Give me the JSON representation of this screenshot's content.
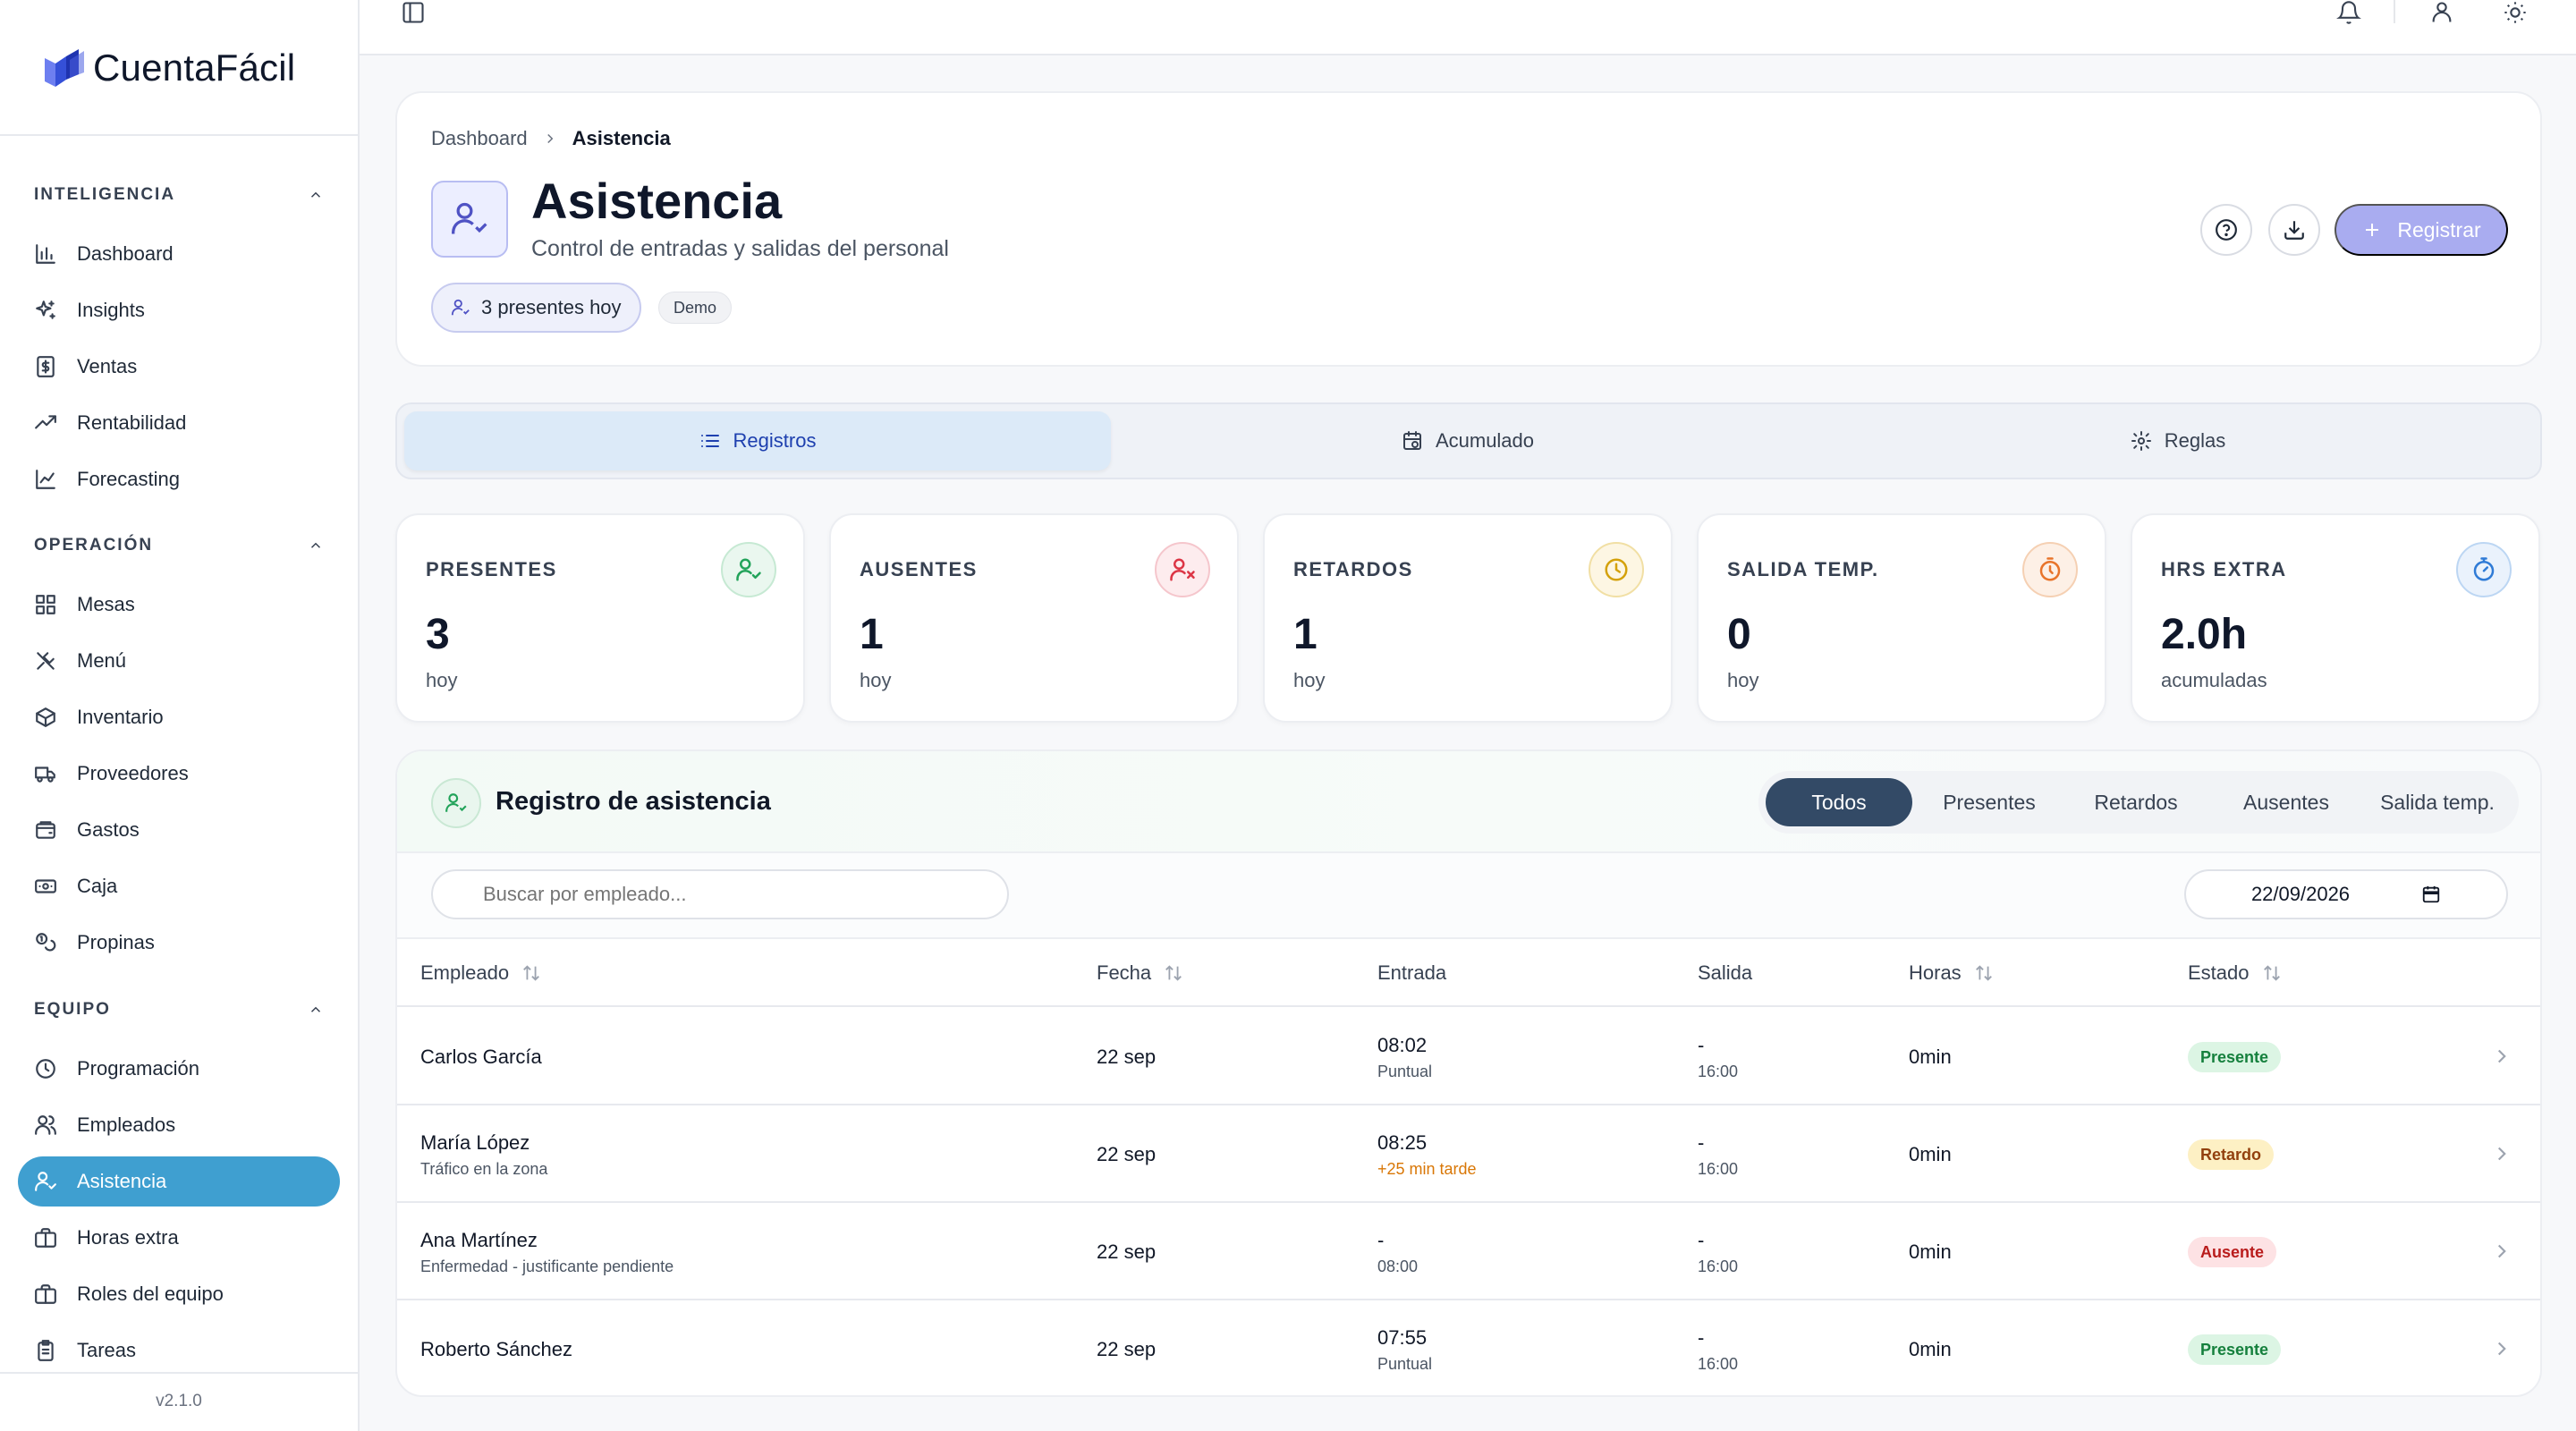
{
  "app": {
    "brand": "CuentaFácil",
    "version": "v2.1.0"
  },
  "sidebar": {
    "sections": [
      {
        "title": "INTELIGENCIA",
        "items": [
          {
            "label": "Dashboard",
            "icon": "bar-chart-icon"
          },
          {
            "label": "Insights",
            "icon": "sparkles-icon"
          },
          {
            "label": "Ventas",
            "icon": "receipt-icon"
          },
          {
            "label": "Rentabilidad",
            "icon": "trending-up-icon"
          },
          {
            "label": "Forecasting",
            "icon": "line-chart-icon"
          }
        ]
      },
      {
        "title": "OPERACIÓN",
        "items": [
          {
            "label": "Mesas",
            "icon": "grid-icon"
          },
          {
            "label": "Menú",
            "icon": "utensils-icon"
          },
          {
            "label": "Inventario",
            "icon": "package-icon"
          },
          {
            "label": "Proveedores",
            "icon": "truck-icon"
          },
          {
            "label": "Gastos",
            "icon": "wallet-icon"
          },
          {
            "label": "Caja",
            "icon": "banknote-icon"
          },
          {
            "label": "Propinas",
            "icon": "coins-icon"
          }
        ]
      },
      {
        "title": "EQUIPO",
        "items": [
          {
            "label": "Programación",
            "icon": "clock-icon"
          },
          {
            "label": "Empleados",
            "icon": "users-icon"
          },
          {
            "label": "Asistencia",
            "icon": "user-check-icon",
            "active": true
          },
          {
            "label": "Horas extra",
            "icon": "briefcase-icon"
          },
          {
            "label": "Roles del equipo",
            "icon": "briefcase-icon"
          },
          {
            "label": "Tareas",
            "icon": "clipboard-icon"
          }
        ]
      }
    ]
  },
  "header": {
    "breadcrumb": {
      "parent": "Dashboard",
      "current": "Asistencia"
    },
    "title": "Asistencia",
    "subtitle": "Control de entradas y salidas del personal",
    "present_pill": "3 presentes hoy",
    "demo_badge": "Demo",
    "register_label": "Registrar"
  },
  "tabs": [
    {
      "label": "Registros",
      "icon": "list-icon",
      "active": true
    },
    {
      "label": "Acumulado",
      "icon": "calendar-clock-icon"
    },
    {
      "label": "Reglas",
      "icon": "gear-icon"
    }
  ],
  "stats": [
    {
      "label": "PRESENTES",
      "value": "3",
      "sub": "hoy",
      "icon": "user-check-icon",
      "color": "#22a35a",
      "bg": "#eaf7ef",
      "border": "#c6e9d3"
    },
    {
      "label": "AUSENTES",
      "value": "1",
      "sub": "hoy",
      "icon": "user-x-icon",
      "color": "#dc3545",
      "bg": "#fdecee",
      "border": "#f5c6cc"
    },
    {
      "label": "RETARDOS",
      "value": "1",
      "sub": "hoy",
      "icon": "clock-icon",
      "color": "#d4a10a",
      "bg": "#fdf6e3",
      "border": "#f1dfa4"
    },
    {
      "label": "SALIDA TEMP.",
      "value": "0",
      "sub": "hoy",
      "icon": "timer-icon",
      "color": "#e8742a",
      "bg": "#fdf0e6",
      "border": "#f5d0b3"
    },
    {
      "label": "HRS EXTRA",
      "value": "2.0h",
      "sub": "acumuladas",
      "icon": "stopwatch-icon",
      "color": "#2f7bd6",
      "bg": "#eaf2fc",
      "border": "#bcd6f3"
    }
  ],
  "table": {
    "title": "Registro de asistencia",
    "filters": [
      "Todos",
      "Presentes",
      "Retardos",
      "Ausentes",
      "Salida temp."
    ],
    "active_filter": "Todos",
    "search_placeholder": "Buscar por empleado...",
    "date_value": "22/09/2026",
    "columns": [
      "Empleado",
      "Fecha",
      "Entrada",
      "Salida",
      "Horas",
      "Estado"
    ],
    "rows": [
      {
        "employee": "Carlos García",
        "note": "",
        "date": "22 sep",
        "in": "08:02",
        "in_note": "Puntual",
        "in_late": false,
        "out": "-",
        "out_note": "16:00",
        "hours": "0min",
        "status": "Presente",
        "status_color": "#15803d",
        "status_bg": "#dcf5e4"
      },
      {
        "employee": "María López",
        "note": "Tráfico en la zona",
        "date": "22 sep",
        "in": "08:25",
        "in_note": "+25 min tarde",
        "in_late": true,
        "out": "-",
        "out_note": "16:00",
        "hours": "0min",
        "status": "Retardo",
        "status_color": "#92400e",
        "status_bg": "#fdf0c4"
      },
      {
        "employee": "Ana Martínez",
        "note": "Enfermedad - justificante pendiente",
        "date": "22 sep",
        "in": "-",
        "in_note": "08:00",
        "in_late": false,
        "out": "-",
        "out_note": "16:00",
        "hours": "0min",
        "status": "Ausente",
        "status_color": "#b91c1c",
        "status_bg": "#fde2e4"
      },
      {
        "employee": "Roberto Sánchez",
        "note": "",
        "date": "22 sep",
        "in": "07:55",
        "in_note": "Puntual",
        "in_late": false,
        "out": "-",
        "out_note": "16:00",
        "hours": "0min",
        "status": "Presente",
        "status_color": "#15803d",
        "status_bg": "#dcf5e4"
      }
    ]
  }
}
